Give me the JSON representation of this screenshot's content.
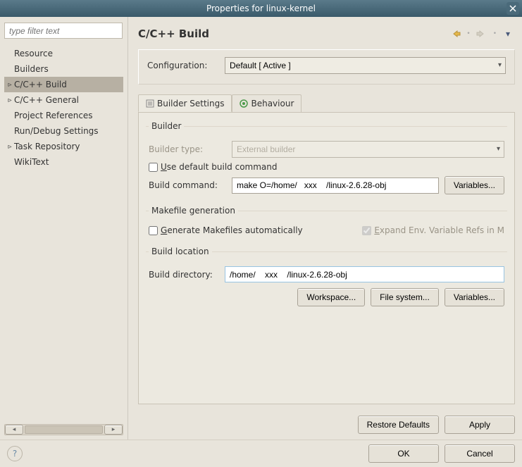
{
  "window": {
    "title": "Properties for linux-kernel"
  },
  "filter": {
    "placeholder": "type filter text"
  },
  "tree": {
    "items": [
      {
        "label": "Resource",
        "arrow": false
      },
      {
        "label": "Builders",
        "arrow": false
      },
      {
        "label": "C/C++ Build",
        "arrow": true,
        "selected": true
      },
      {
        "label": "C/C++ General",
        "arrow": true
      },
      {
        "label": "Project References",
        "arrow": false
      },
      {
        "label": "Run/Debug Settings",
        "arrow": false
      },
      {
        "label": "Task Repository",
        "arrow": true
      },
      {
        "label": "WikiText",
        "arrow": false
      }
    ]
  },
  "page": {
    "title": "C/C++ Build"
  },
  "config": {
    "label": "Configuration:",
    "value": "Default  [ Active ]"
  },
  "tabs": {
    "builder_settings": "Builder Settings",
    "behaviour": "Behaviour"
  },
  "builder": {
    "legend": "Builder",
    "type_label": "Builder type:",
    "type_value": "External builder",
    "use_default_label": "Use default build command",
    "command_label": "Build command:",
    "command_value": "make O=/home/   xxx    /linux-2.6.28-obj",
    "variables_btn": "Variables..."
  },
  "makefile": {
    "legend": "Makefile generation",
    "generate_label": "Generate Makefiles automatically",
    "expand_label": "Expand Env. Variable Refs in M"
  },
  "location": {
    "legend": "Build location",
    "dir_label": "Build directory:",
    "dir_value": "/home/    xxx    /linux-2.6.28-obj",
    "workspace_btn": "Workspace...",
    "filesystem_btn": "File system...",
    "variables_btn": "Variables..."
  },
  "bottom": {
    "restore": "Restore Defaults",
    "apply": "Apply"
  },
  "footer": {
    "ok": "OK",
    "cancel": "Cancel"
  }
}
